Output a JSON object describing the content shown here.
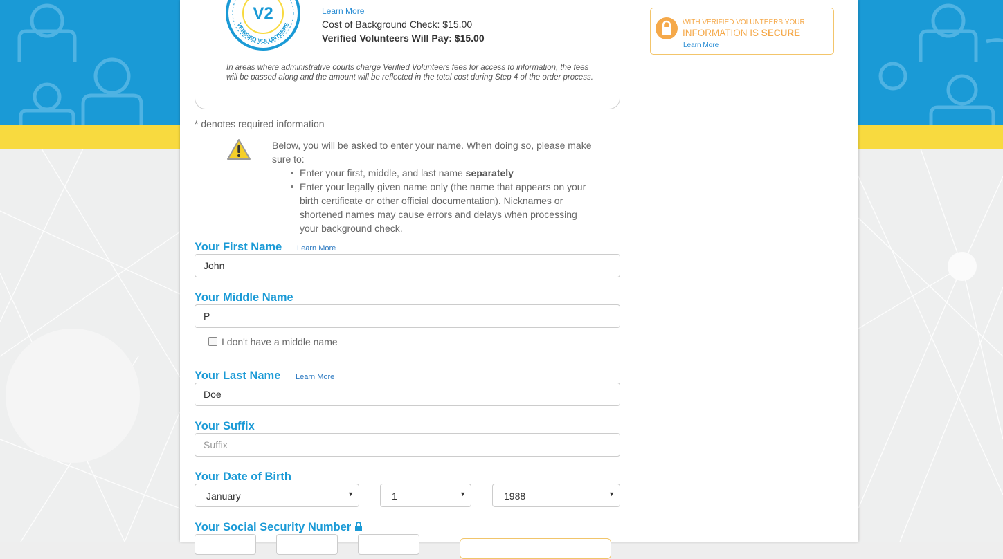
{
  "info_card": {
    "seal_text_top": "VERIFIED VOLUNTEERS",
    "seal_text_bottom": "VERIFIED VOLUNTEERS",
    "seal_logo": "V2",
    "learn_more": "Learn More",
    "cost_line": "Cost of Background Check: $15.00",
    "pay_line": "Verified Volunteers Will Pay: $15.00",
    "fees_note": "In areas where administrative courts charge Verified Volunteers fees for access to information, the fees will be passed along and the amount will be reflected in the total cost during Step 4 of the order process."
  },
  "required_note": "* denotes required information",
  "warning": {
    "icon": "warning-triangle-icon",
    "intro": "Below, you will be asked to enter your name. When doing so, please make sure to:",
    "bullet1_prefix": "Enter your first, middle, and last name ",
    "bullet1_bold": "separately",
    "bullet2": "Enter your legally given name only (the name that appears on your birth certificate or other official documentation). Nicknames or shortened names may cause errors and delays when processing your background check."
  },
  "form": {
    "first_name": {
      "label": "Your First Name",
      "learn_more": "Learn More",
      "value": "John"
    },
    "middle_name": {
      "label": "Your Middle Name",
      "value": "P",
      "no_middle_label": "I don't have a middle name"
    },
    "last_name": {
      "label": "Your Last Name",
      "learn_more": "Learn More",
      "value": "Doe"
    },
    "suffix": {
      "label": "Your Suffix",
      "placeholder": "Suffix"
    },
    "dob": {
      "label": "Your Date of Birth",
      "month": "January",
      "day": "1",
      "year": "1988"
    },
    "ssn": {
      "label": "Your Social Security Number",
      "icon": "lock-icon"
    }
  },
  "secure_box": {
    "line1": "WITH VERIFIED VOLUNTEERS,YOUR",
    "line2_prefix": "INFORMATION IS ",
    "line2_bold": "SECURE",
    "learn_more": "Learn More",
    "icon": "padlock-icon",
    "color": "#f5a94a"
  },
  "colors": {
    "header_blue": "#1a9ad6",
    "band_yellow": "#f8da3f",
    "label_blue": "#1a9ad6",
    "link_blue": "#2a8dd4"
  }
}
